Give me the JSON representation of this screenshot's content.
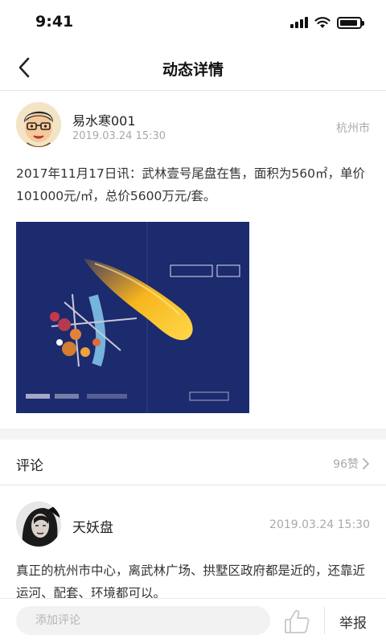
{
  "status_bar": {
    "time": "9:41",
    "signal_icon": "cellular-signal-icon",
    "wifi_icon": "wifi-icon",
    "battery_icon": "battery-icon",
    "battery_level": 0.9
  },
  "nav": {
    "back_icon": "chevron-left-icon",
    "title": "动态详情"
  },
  "post": {
    "author": "易水寒001",
    "time": "2019.03.24 15:30",
    "city": "杭州市",
    "text": "2017年11月17日讯：武林壹号尾盘在售，面积为560㎡，单价101000元/㎡，总价5600万元/套。"
  },
  "comments_section": {
    "title": "评论",
    "likes": "96赞",
    "chevron_icon": "chevron-right-icon"
  },
  "comments": [
    {
      "name": "天妖盘",
      "time": "2019.03.24 15:30",
      "text": "真正的杭州市中心，离武林广场、拱墅区政府都是近的，还靠近运河、配套、环境都可以。"
    }
  ],
  "bottom_bar": {
    "comment_placeholder": "添加评论",
    "like_icon": "thumbs-up-icon",
    "report_label": "举报"
  },
  "colors": {
    "text_primary": "#222222",
    "text_secondary": "#a9a9a9",
    "divider": "#e6e6e6",
    "gap_bg": "#f4f4f4",
    "input_bg": "#f2f2f2",
    "brochure_blue": "#1d2a6b"
  }
}
